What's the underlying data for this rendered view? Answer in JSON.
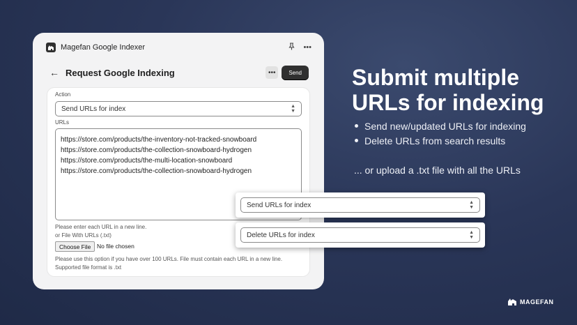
{
  "app": {
    "name": "Magefan Google Indexer",
    "pin_icon": "pin-icon",
    "more_icon": "more-icon"
  },
  "page": {
    "title": "Request Google Indexing",
    "send_label": "Send"
  },
  "form": {
    "action_label": "Action",
    "action_value": "Send URLs for index",
    "urls_label": "URLs",
    "urls": [
      "https://store.com/products/the-inventory-not-tracked-snowboard",
      "https://store.com/products/the-collection-snowboard-hydrogen",
      "https://store.com/products/the-multi-location-snowboard",
      "https://store.com/products/the-collection-snowboard-hydrogen"
    ],
    "urls_help": "Please enter each URL in a new line.",
    "file_label": "or File With URLs (.txt)",
    "file_button": "Choose File",
    "file_status": "No file chosen",
    "file_help_1": "Please use this option if you have over 100 URLs. File must contain each URL in a new line.",
    "file_help_2": "Supported file format is .txt"
  },
  "options": {
    "send": "Send URLs for index",
    "delete": "Delete URLs for index"
  },
  "promo": {
    "heading": "Submit multiple URLs for indexing",
    "bullets": [
      "Send new/updated URLs for indexing",
      "Delete URLs from search results"
    ],
    "note": "... or upload a .txt file with all the URLs"
  },
  "brand": {
    "name": "MAGEFAN"
  },
  "colors": {
    "background": "#2a3658",
    "card": "#f3f3f4",
    "button_dark": "#303030"
  }
}
